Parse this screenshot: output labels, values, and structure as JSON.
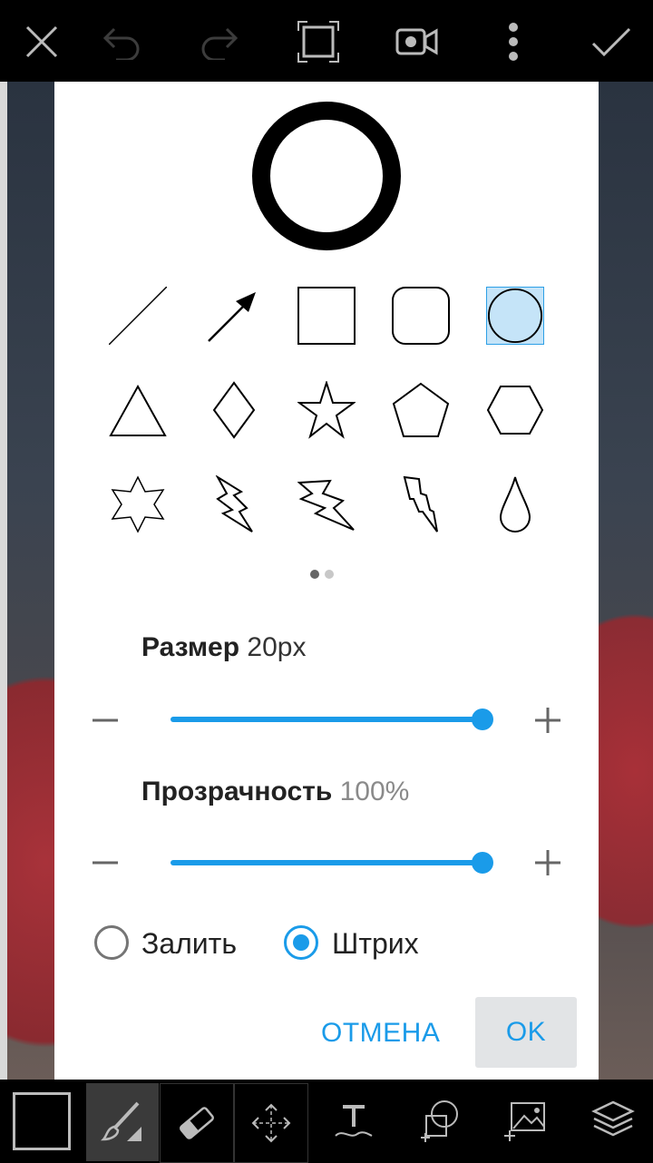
{
  "toolbar": {
    "icons": [
      "close-icon",
      "undo-icon",
      "redo-icon",
      "crop-frame-icon",
      "video-camera-icon",
      "more-vertical-icon",
      "check-icon"
    ]
  },
  "shape_dialog": {
    "shapes": [
      "line",
      "arrow",
      "square",
      "rounded-square",
      "circle",
      "triangle",
      "diamond",
      "star",
      "pentagon",
      "hexagon",
      "six-point-star",
      "lightning-1",
      "lightning-2",
      "lightning-3",
      "drop"
    ],
    "selected_shape": "circle",
    "page_indicator": {
      "pages": 2,
      "current": 1
    },
    "size": {
      "label": "Размер",
      "value": "20px",
      "level": 1.0
    },
    "opacity": {
      "label": "Прозрачность",
      "value": "100%",
      "level": 1.0
    },
    "fill_label": "Залить",
    "stroke_label": "Штрих",
    "selected_mode": "stroke",
    "cancel_label": "ОТМЕНА",
    "ok_label": "OK"
  },
  "bottom_toolbar": {
    "icons": [
      "color-swatch",
      "brush-icon",
      "eraser-icon",
      "move-icon",
      "text-icon",
      "shape-icon",
      "add-photo-icon",
      "layers-icon"
    ]
  },
  "colors": {
    "accent": "#1a9be9",
    "selected_bg": "#c5e4f8"
  }
}
